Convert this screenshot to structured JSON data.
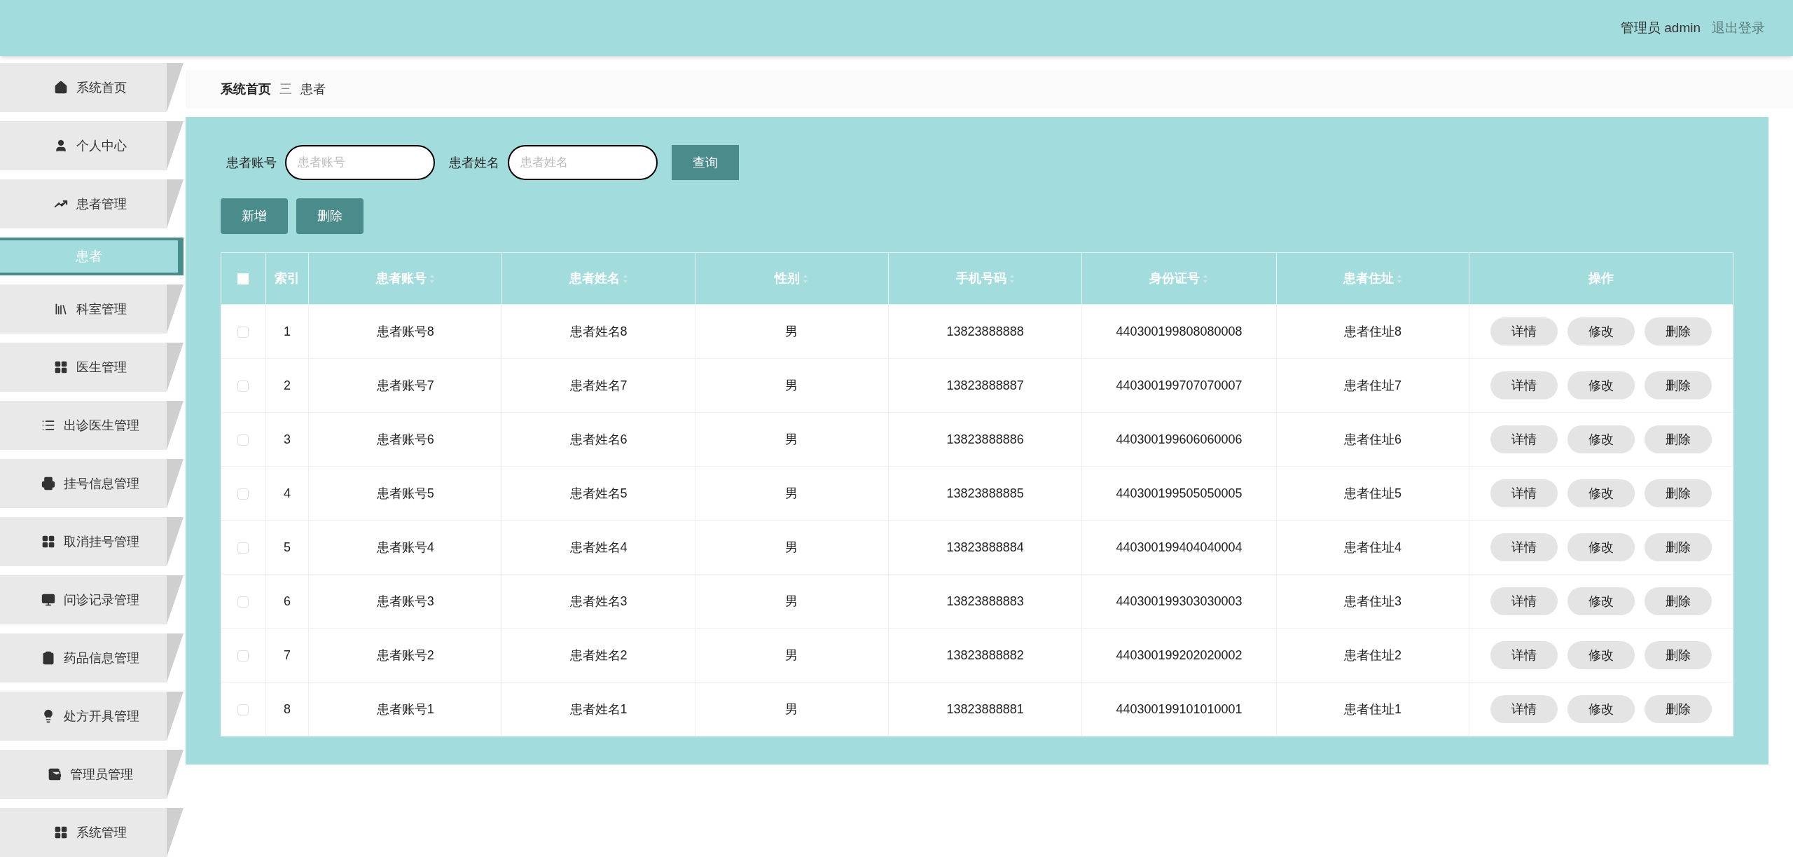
{
  "header": {
    "user_label": "管理员 admin",
    "logout": "退出登录"
  },
  "sidebar": {
    "items": [
      {
        "kind": "menu",
        "label": "系统首页",
        "selected": false
      },
      {
        "kind": "menu",
        "label": "个人中心",
        "selected": false
      },
      {
        "kind": "menu",
        "label": "患者管理",
        "selected": false
      },
      {
        "kind": "submenu",
        "label": "患者",
        "selected": true
      },
      {
        "kind": "menu",
        "label": "科室管理",
        "selected": false
      },
      {
        "kind": "menu",
        "label": "医生管理",
        "selected": false
      },
      {
        "kind": "menu",
        "label": "出诊医生管理",
        "selected": false
      },
      {
        "kind": "menu",
        "label": "挂号信息管理",
        "selected": false
      },
      {
        "kind": "menu",
        "label": "取消挂号管理",
        "selected": false
      },
      {
        "kind": "menu",
        "label": "问诊记录管理",
        "selected": false
      },
      {
        "kind": "menu",
        "label": "药品信息管理",
        "selected": false
      },
      {
        "kind": "menu",
        "label": "处方开具管理",
        "selected": false
      },
      {
        "kind": "menu",
        "label": "管理员管理",
        "selected": false
      },
      {
        "kind": "menu",
        "label": "系统管理",
        "selected": false
      }
    ]
  },
  "breadcrumb": {
    "items": [
      "系统首页",
      "患者"
    ],
    "separator": "三"
  },
  "search": {
    "fields": [
      {
        "label": "患者账号",
        "placeholder": "患者账号"
      },
      {
        "label": "患者姓名",
        "placeholder": "患者姓名"
      }
    ],
    "button": "查询"
  },
  "actions": [
    "新增",
    "删除"
  ],
  "table": {
    "columns": [
      {
        "label": "索引",
        "sortable": false
      },
      {
        "label": "患者账号",
        "sortable": true
      },
      {
        "label": "患者姓名",
        "sortable": true
      },
      {
        "label": "性别",
        "sortable": true
      },
      {
        "label": "手机号码",
        "sortable": true
      },
      {
        "label": "身份证号",
        "sortable": true
      },
      {
        "label": "患者住址",
        "sortable": true
      },
      {
        "label": "操作",
        "sortable": false
      }
    ],
    "select_all": false,
    "rows": [
      {
        "selected": false,
        "cells": [
          "1",
          "患者账号8",
          "患者姓名8",
          "男",
          "13823888888",
          "440300199808080008",
          "患者住址8"
        ],
        "actions": [
          "详情",
          "修改",
          "删除"
        ]
      },
      {
        "selected": false,
        "cells": [
          "2",
          "患者账号7",
          "患者姓名7",
          "男",
          "13823888887",
          "440300199707070007",
          "患者住址7"
        ],
        "actions": [
          "详情",
          "修改",
          "删除"
        ]
      },
      {
        "selected": false,
        "cells": [
          "3",
          "患者账号6",
          "患者姓名6",
          "男",
          "13823888886",
          "440300199606060006",
          "患者住址6"
        ],
        "actions": [
          "详情",
          "修改",
          "删除"
        ]
      },
      {
        "selected": false,
        "cells": [
          "4",
          "患者账号5",
          "患者姓名5",
          "男",
          "13823888885",
          "440300199505050005",
          "患者住址5"
        ],
        "actions": [
          "详情",
          "修改",
          "删除"
        ]
      },
      {
        "selected": false,
        "cells": [
          "5",
          "患者账号4",
          "患者姓名4",
          "男",
          "13823888884",
          "440300199404040004",
          "患者住址4"
        ],
        "actions": [
          "详情",
          "修改",
          "删除"
        ]
      },
      {
        "selected": false,
        "cells": [
          "6",
          "患者账号3",
          "患者姓名3",
          "男",
          "13823888883",
          "440300199303030003",
          "患者住址3"
        ],
        "actions": [
          "详情",
          "修改",
          "删除"
        ]
      },
      {
        "selected": false,
        "cells": [
          "7",
          "患者账号2",
          "患者姓名2",
          "男",
          "13823888882",
          "440300199202020002",
          "患者住址2"
        ],
        "actions": [
          "详情",
          "修改",
          "删除"
        ]
      },
      {
        "selected": false,
        "cells": [
          "8",
          "患者账号1",
          "患者姓名1",
          "男",
          "13823888881",
          "440300199101010001",
          "患者住址1"
        ],
        "actions": [
          "详情",
          "修改",
          "删除"
        ]
      }
    ]
  }
}
